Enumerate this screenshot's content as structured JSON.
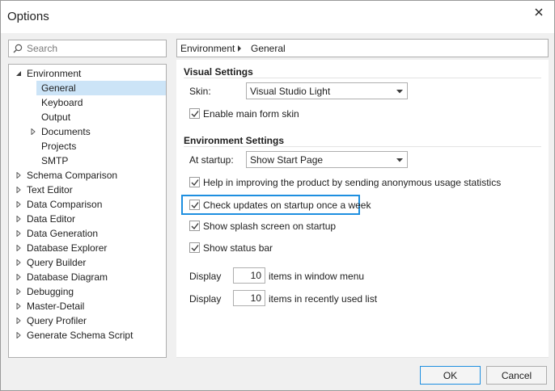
{
  "window": {
    "title": "Options"
  },
  "search": {
    "placeholder": "Search"
  },
  "tree": {
    "items": [
      {
        "label": "Environment",
        "expanded": true,
        "level": 0,
        "has_children": true
      },
      {
        "label": "General",
        "level": 1,
        "selected": true,
        "has_children": false
      },
      {
        "label": "Keyboard",
        "level": 1,
        "has_children": false
      },
      {
        "label": "Output",
        "level": 1,
        "has_children": false
      },
      {
        "label": "Documents",
        "level": 1,
        "has_children": true
      },
      {
        "label": "Projects",
        "level": 1,
        "has_children": false
      },
      {
        "label": "SMTP",
        "level": 1,
        "has_children": false
      },
      {
        "label": "Schema Comparison",
        "level": 0,
        "has_children": true
      },
      {
        "label": "Text Editor",
        "level": 0,
        "has_children": true
      },
      {
        "label": "Data Comparison",
        "level": 0,
        "has_children": true
      },
      {
        "label": "Data Editor",
        "level": 0,
        "has_children": true
      },
      {
        "label": "Data Generation",
        "level": 0,
        "has_children": true
      },
      {
        "label": "Database Explorer",
        "level": 0,
        "has_children": true
      },
      {
        "label": "Query Builder",
        "level": 0,
        "has_children": true
      },
      {
        "label": "Database Diagram",
        "level": 0,
        "has_children": true
      },
      {
        "label": "Debugging",
        "level": 0,
        "has_children": true
      },
      {
        "label": "Master-Detail",
        "level": 0,
        "has_children": true
      },
      {
        "label": "Query Profiler",
        "level": 0,
        "has_children": true
      },
      {
        "label": "Generate Schema Script",
        "level": 0,
        "has_children": true
      }
    ]
  },
  "breadcrumb": {
    "part1": "Environment",
    "part2": "General"
  },
  "visual_settings": {
    "title": "Visual Settings",
    "skin_label": "Skin:",
    "skin_value": "Visual Studio Light",
    "enable_skin_label": "Enable main form skin",
    "enable_skin_checked": true
  },
  "environment_settings": {
    "title": "Environment Settings",
    "startup_label": "At startup:",
    "startup_value": "Show Start Page",
    "checks": [
      {
        "label": "Help in improving the product by sending anonymous usage statistics",
        "checked": true
      },
      {
        "label": "Check updates on startup once a week",
        "checked": true,
        "highlighted": true
      },
      {
        "label": "Show splash screen on startup",
        "checked": true
      },
      {
        "label": "Show status bar",
        "checked": true
      }
    ],
    "display_label": "Display",
    "window_menu_count": "10",
    "window_menu_suffix": "items in window menu",
    "recent_count": "10",
    "recent_suffix": "items in recently used list"
  },
  "buttons": {
    "ok": "OK",
    "cancel": "Cancel"
  },
  "colors": {
    "selection": "#cce4f7",
    "highlight_border": "#1e8fe0",
    "primary_border": "#1e8fe0"
  },
  "icons": {
    "close": "close-icon",
    "search": "search-icon",
    "expand": "chevron-right-icon",
    "collapse": "chevron-down-icon",
    "check": "check-icon",
    "dropdown": "dropdown-arrow-icon"
  }
}
